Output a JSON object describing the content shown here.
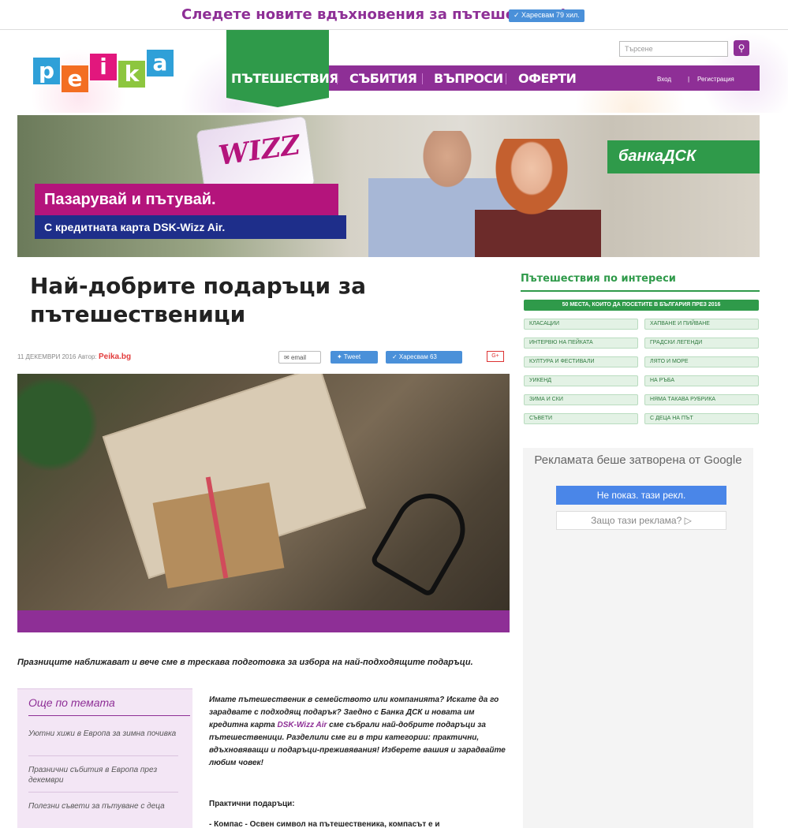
{
  "topbar": {
    "headline": "Следете новите вдъхновения за пътешествия!",
    "like_label": "✓ Харесвам 79 хил."
  },
  "header": {
    "logo_letters": [
      "p",
      "e",
      "i",
      "k",
      "a"
    ],
    "search_placeholder": "Търсене",
    "search_icon": "search-icon",
    "nav": [
      "ПЪТЕШЕСТВИЯ",
      "СЪБИТИЯ",
      "ВЪПРОСИ",
      "ОФЕРТИ"
    ],
    "login": "Вход",
    "auth_sep": "|",
    "register": "Регистрация"
  },
  "hero_ad": {
    "card_text": "WIZZ",
    "line1": "Пазарувай и пътувай.",
    "line2": "С кредитната карта DSK-Wizz Air.",
    "bank": "банкаДСК"
  },
  "article": {
    "title": "Най-добрите подаръци за пътешественици",
    "date": "11 ДЕКЕМВРИ 2016",
    "author_label": "Автор:",
    "author": "Peika.bg",
    "share_email": "email",
    "share_tweet": "Tweet",
    "share_like": "✓ Харесвам 63",
    "share_gplus": "G+",
    "lead": "Празниците наближават и вече сме в трескава подготовка за избора на най-подходящите подаръци.",
    "body_1": "Имате пътешественик в семейството или компанията? Искате да го зарадвате с подходящ подарък? Заедно с Банка ДСК и новата им кредитна карта ",
    "body_link": "DSK-Wizz Air",
    "body_2": " сме събрали най-добрите подаръци за пътешественици. Разделили сме ги в три категории: практични, вдъхновяващи и подаръци-преживявания! Изберете вашия и зарадвайте любим човек!",
    "section_head": "Практични подаръци:",
    "bullet": "- Компас - Освен символ на пътешественика, компасът е и"
  },
  "more": {
    "title": "Още по темата",
    "items": [
      "Уютни хижи в Европа за зимна почивка",
      "Празнични събития в Европа през декември",
      "Полезни съвети за пътуване с деца"
    ]
  },
  "sidebar": {
    "title": "Пътешествия по интереси",
    "featured_tag": "50 МЕСТА, КОИТО ДА ПОСЕТИТЕ В БЪЛГАРИЯ ПРЕЗ 2016",
    "tags": [
      "КЛАСАЦИИ",
      "ХАПВАНЕ И ПИЙВАНЕ",
      "ИНТЕРВЮ НА ПЕЙКАТА",
      "ГРАДСКИ ЛЕГЕНДИ",
      "КУЛТУРА И ФЕСТИВАЛИ",
      "ЛЯТО И МОРЕ",
      "УИКЕНД",
      "НА РЪБА",
      "ЗИМА И СКИ",
      "НЯМА ТАКАВА РУБРИКА",
      "СЪВЕТИ",
      "С ДЕЦА НА ПЪТ"
    ],
    "ad_closed_text": "Рекламата беше затворена от Google",
    "ad_hide": "Не показ. тази рекл.",
    "ad_why": "Защо тази реклама? ▷"
  },
  "colors": {
    "brand_purple": "#8e2f96",
    "brand_green": "#2f9a4a",
    "facebook_blue": "#4a90d9"
  }
}
